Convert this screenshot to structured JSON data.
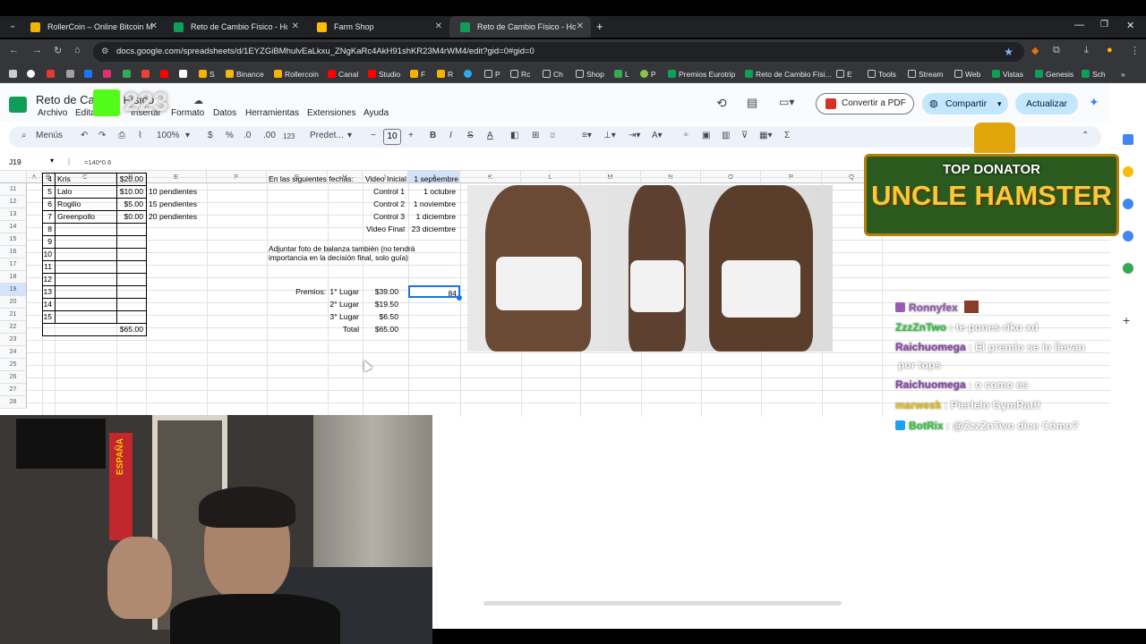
{
  "browser": {
    "tabs": [
      {
        "label": "RollerCoin – Online Bitcoin Mini",
        "fav_color": "#f4b400"
      },
      {
        "label": "Reto de Cambio Físico - Hojas d",
        "fav_color": "#0f9d58"
      },
      {
        "label": "Farm Shop",
        "fav_color": "#fbbc04"
      },
      {
        "label": "Reto de Cambio Físico - Hojas d",
        "fav_color": "#0f9d58"
      }
    ],
    "new_tab": "+",
    "url": "docs.google.com/spreadsheets/d/1EYZGiBMhulvEaLkxu_ZNgKaRc4AkH91shKR23M4rWM4/edit?gid=0#gid=0",
    "bookmarks": [
      "S",
      "Binance",
      "Rollercoin",
      "Canal",
      "Studio",
      "F",
      "R",
      "P",
      "Rc",
      "Ch",
      "Shop",
      "L",
      "P",
      "Premios Eurotrip",
      "Reto de Cambio Físi...",
      "E",
      "Tools",
      "Stream",
      "Web",
      "Vistas",
      "Genesis",
      "Sch"
    ]
  },
  "sheets": {
    "title": "Reto de Cambio Físico",
    "menus": [
      "Archivo",
      "Editar",
      "Ver",
      "Insertar",
      "Formato",
      "Datos",
      "Herramientas",
      "Extensiones",
      "Ayuda"
    ],
    "convert_pdf": "Convertir a PDF",
    "share": "Compartir",
    "update": "Actualizar",
    "toolbar": {
      "menus": "Menús",
      "zoom": "100%",
      "currency": "$",
      "percent": "%",
      "dec_less": ".0",
      "dec_more": ".00",
      "num": "123",
      "font": "Predet...",
      "size": "10",
      "bold": "B",
      "italic": "I",
      "strike": "S",
      "textcolor": "A",
      "sigma": "Σ"
    },
    "name_box": "J19",
    "formula": "=140*0.6",
    "columns": [
      "A",
      "B",
      "C",
      "D",
      "E",
      "F",
      "G",
      "H",
      "I",
      "J",
      "K",
      "L",
      "M",
      "N",
      "O",
      "P",
      "Q"
    ],
    "rows": [
      "11",
      "12",
      "13",
      "14",
      "15",
      "16",
      "17",
      "18",
      "19",
      "20",
      "21",
      "22",
      "23",
      "24",
      "25",
      "26",
      "27",
      "28"
    ],
    "participants": [
      {
        "n": "4",
        "name": "Kris",
        "amount": "$20.00",
        "note": ""
      },
      {
        "n": "5",
        "name": "Lalo",
        "amount": "$10.00",
        "note": "10 pendientes"
      },
      {
        "n": "6",
        "name": "Rogilio",
        "amount": "$5.00",
        "note": "15 pendientes"
      },
      {
        "n": "7",
        "name": "Greenpollo",
        "amount": "$0.00",
        "note": "20 pendientes"
      },
      {
        "n": "8",
        "name": "",
        "amount": "",
        "note": ""
      },
      {
        "n": "9",
        "name": "",
        "amount": "",
        "note": ""
      },
      {
        "n": "10",
        "name": "",
        "amount": "",
        "note": ""
      },
      {
        "n": "11",
        "name": "",
        "amount": "",
        "note": ""
      },
      {
        "n": "12",
        "name": "",
        "amount": "",
        "note": ""
      },
      {
        "n": "13",
        "name": "",
        "amount": "",
        "note": ""
      },
      {
        "n": "14",
        "name": "",
        "amount": "",
        "note": ""
      },
      {
        "n": "15",
        "name": "",
        "amount": "",
        "note": ""
      }
    ],
    "total_amount": "$65.00",
    "dates_header": "En las siguientes fechas:",
    "video_inicial": "Video Inicial",
    "video_inicial_date": "1 septiembre",
    "controls": [
      {
        "label": "Control 1",
        "date": "1 octubre"
      },
      {
        "label": "Control 2",
        "date": "1 noviembre"
      },
      {
        "label": "Control 3",
        "date": "1 diciembre"
      },
      {
        "label": "Video Final",
        "date": "23 diciembre"
      }
    ],
    "note_line1": "Adjuntar foto de balanza también (no tendrá",
    "note_line2": "importancia en la decisión final, solo guía)",
    "prizes_label": "Premios:",
    "prizes": [
      {
        "place": "1° Lugar",
        "amount": "$39.00"
      },
      {
        "place": "2° Lugar",
        "amount": "$19.50"
      },
      {
        "place": "3° Lugar",
        "amount": "$6.50"
      },
      {
        "place": "Total",
        "amount": "$65.00"
      }
    ],
    "selected_value": "84"
  },
  "stream": {
    "badge_number": "223",
    "donator_line1": "TOP DONATOR",
    "donator_line2": "UNCLE HAMSTER",
    "flag_text": "ESPAÑA",
    "chat": [
      {
        "user": "Ronnyfex",
        "msg": "",
        "user_color": "#9b59b6",
        "msg_color": "#ffffff"
      },
      {
        "user": "ZzzZnTwo",
        "msg": ": te pones riko xd",
        "user_color": "#2ecc40",
        "msg_color": "#ffffff"
      },
      {
        "user": "Raichuomega",
        "msg": ": El premio se lo llevan",
        "user_color": "#8e44ad",
        "msg_color": "#ffffff"
      },
      {
        "user": "",
        "msg": "por tops",
        "user_color": "#8e44ad",
        "msg_color": "#ffffff"
      },
      {
        "user": "Raichuomega",
        "msg": ": o como es",
        "user_color": "#8e44ad",
        "msg_color": "#ffffff"
      },
      {
        "user": "marwesk",
        "msg": ": Pierlelo GymRat!!",
        "user_color": "#f1c40f",
        "msg_color": "#ffffff"
      },
      {
        "user": "BotRix",
        "msg": ": @ZzzZnTwo dice Cómo?",
        "user_color": "#2ecc40",
        "msg_color": "#ffffff"
      }
    ]
  }
}
